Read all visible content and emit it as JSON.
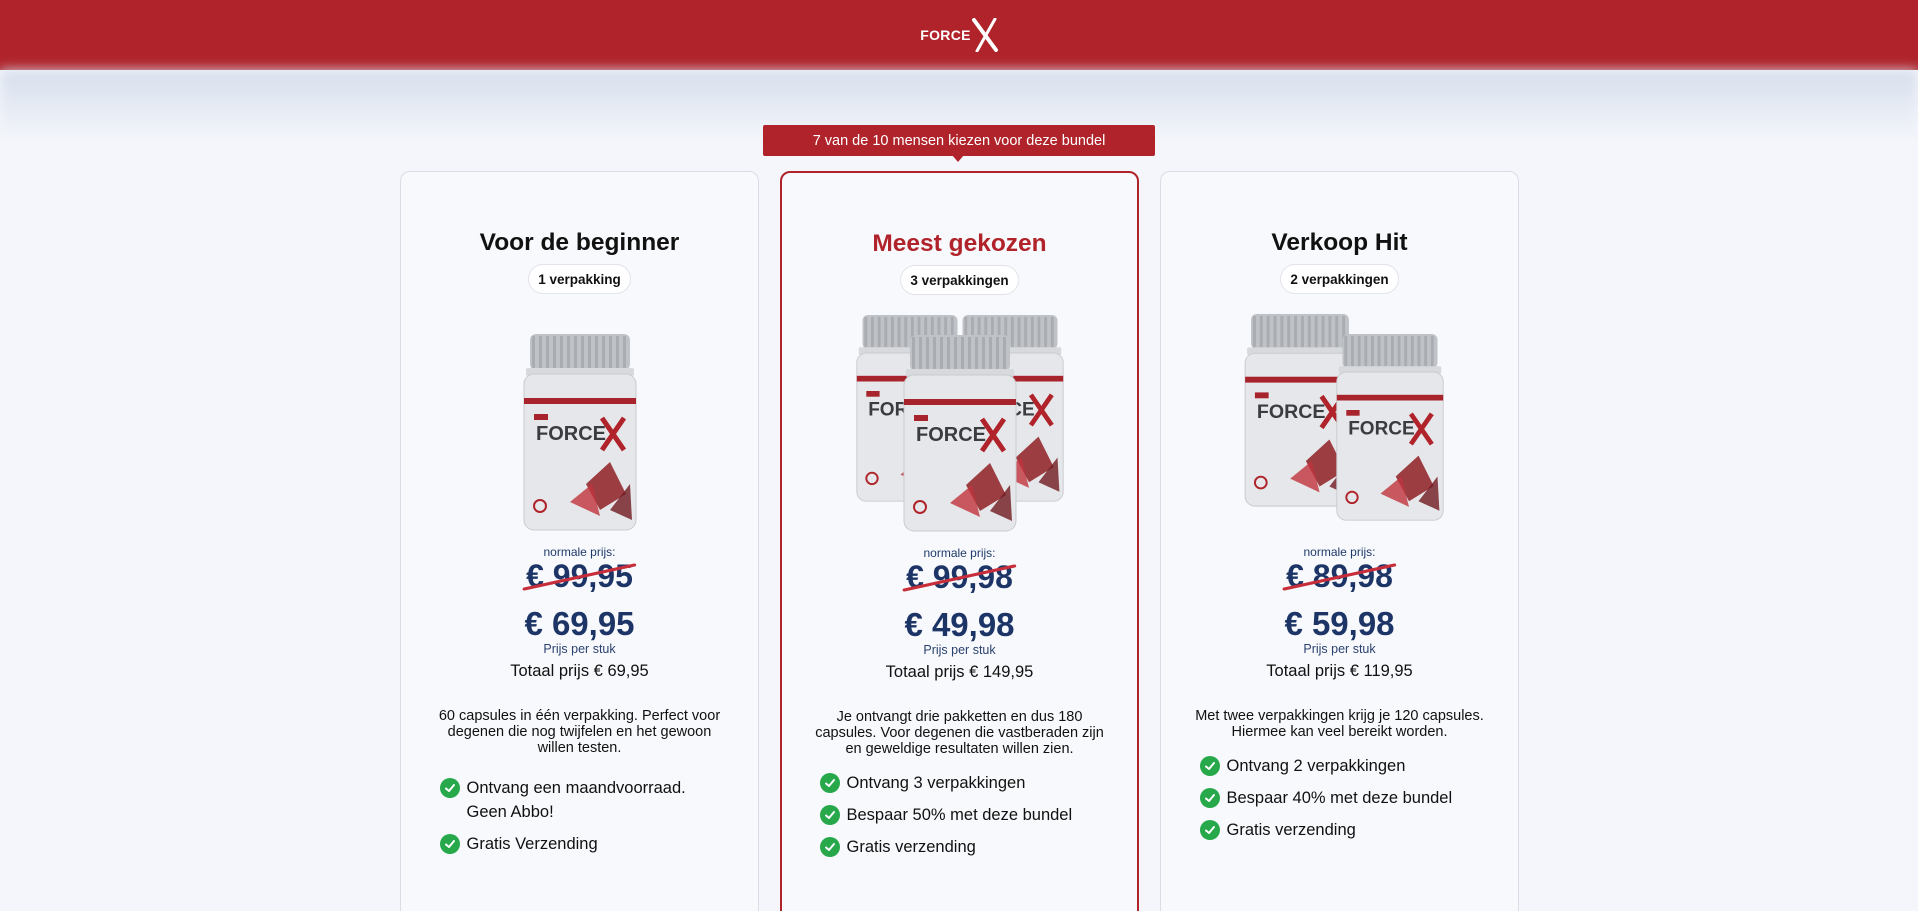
{
  "header": {
    "logo_text": "FORCE",
    "logo_letter": "X"
  },
  "ribbon": {
    "text": "7 van de 10 mensen kiezen voor deze bundel"
  },
  "cards": [
    {
      "title": "Voor de beginner",
      "badge": "1 verpakking",
      "bottles": 1,
      "normal_label": "normale prijs:",
      "old_price": "€ 99,95",
      "new_price": "€ 69,95",
      "per_unit": "Prijs per stuk",
      "total": "Totaal prijs € 69,95",
      "description": "60 capsules in één verpakking. Perfect voor degenen die nog twijfelen en het gewoon willen testen.",
      "features": [
        "Ontvang een maandvoorraad. Geen Abbo!",
        "Gratis Verzending"
      ]
    },
    {
      "title": "Meest gekozen",
      "badge": "3 verpakkingen",
      "bottles": 3,
      "normal_label": "normale prijs:",
      "old_price": "€ 99,98",
      "new_price": "€ 49,98",
      "per_unit": "Prijs per stuk",
      "total": "Totaal prijs € 149,95",
      "description": "Je ontvangt drie pakketten en dus 180 capsules. Voor degenen die vastberaden zijn en geweldige resultaten willen zien.",
      "features": [
        "Ontvang 3 verpakkingen",
        "Bespaar 50% met deze bundel",
        "Gratis verzending"
      ]
    },
    {
      "title": "Verkoop Hit",
      "badge": "2 verpakkingen",
      "bottles": 2,
      "normal_label": "normale prijs:",
      "old_price": "€ 89,98",
      "new_price": "€ 59,98",
      "per_unit": "Prijs per stuk",
      "total": "Totaal prijs € 119,95",
      "description": "Met twee verpakkingen krijg je 120 capsules. Hiermee kan veel bereikt worden.",
      "features": [
        "Ontvang 2 verpakkingen",
        "Bespaar 40% met deze bundel",
        "Gratis verzending"
      ]
    }
  ],
  "colors": {
    "brand_red": "#b0232a",
    "price_navy": "#1c3566",
    "check_green": "#27a84a"
  },
  "icons": {
    "feature": "check-circle-icon",
    "bottle": "product-bottle-icon"
  }
}
